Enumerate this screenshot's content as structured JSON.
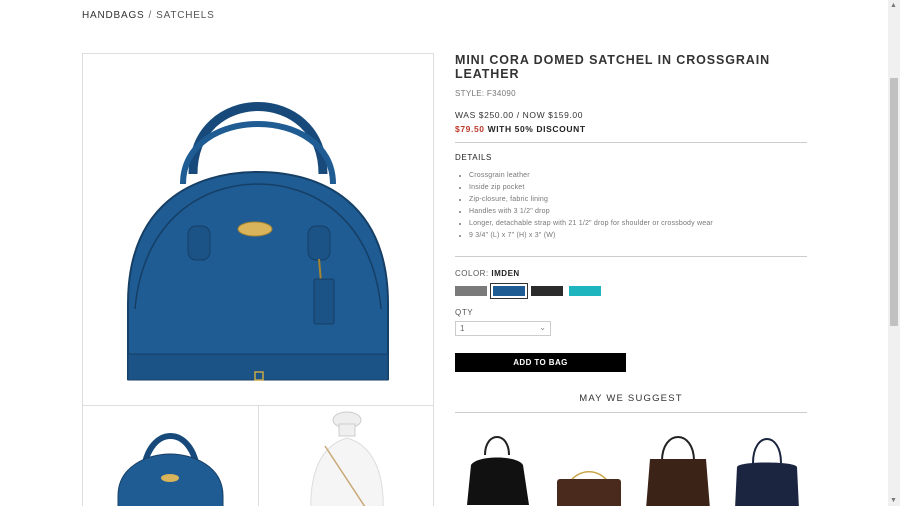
{
  "breadcrumb": {
    "parent": "HANDBAGS",
    "separator": "/",
    "current": "SATCHELS"
  },
  "product": {
    "title": "MINI CORA DOMED SATCHEL IN CROSSGRAIN LEATHER",
    "style": "STYLE: F34090",
    "price_was_now": "WAS $250.00 / NOW $159.00",
    "discount_price": "$79.50",
    "discount_text": "WITH 50% DISCOUNT",
    "details_heading": "DETAILS",
    "details": [
      "Crossgrain leather",
      "Inside zip pocket",
      "Zip-closure, fabric lining",
      "Handles with 3 1/2\" drop",
      "Longer, detachable strap with 21 1/2\" drop for shoulder or crossbody wear",
      "9 3/4\" (L) x 7\" (H) x 3\" (W)"
    ],
    "color_label": "COLOR:",
    "color_value": "IMDEN",
    "swatches": [
      {
        "name": "grey",
        "color": "#7a7a7a"
      },
      {
        "name": "imden",
        "color": "#1f5c94",
        "selected": true
      },
      {
        "name": "black",
        "color": "#2b2b2b"
      },
      {
        "name": "turquoise",
        "color": "#1fb5be"
      }
    ],
    "qty_label": "QTY",
    "qty_value": "1",
    "add_to_bag": "ADD TO BAG"
  },
  "suggest": {
    "heading": "MAY WE SUGGEST"
  },
  "colors": {
    "bag_blue": "#1f5c94",
    "bag_blue_dark": "#174a7a",
    "accent_red": "#c0392b"
  }
}
